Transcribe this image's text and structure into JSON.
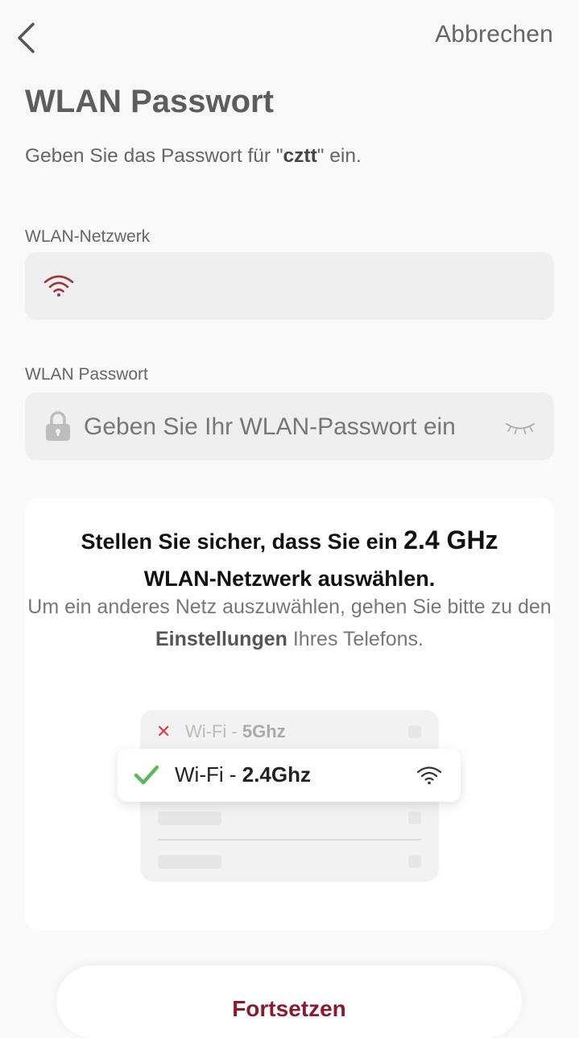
{
  "header": {
    "cancel_label": "Abbrechen"
  },
  "page": {
    "title": "WLAN Passwort",
    "subtitle_prefix": "Geben Sie das Passwort für \"",
    "network_name": "cztt",
    "subtitle_suffix": "\" ein."
  },
  "network_field": {
    "label": "WLAN-Netzwerk",
    "value": "",
    "icon": "wifi-icon"
  },
  "password_field": {
    "label": "WLAN Passwort",
    "placeholder": "Geben Sie Ihr WLAN-Passwort ein",
    "icon": "lock-icon",
    "toggle_icon": "eye-closed-icon"
  },
  "info_card": {
    "heading_part1": "Stellen Sie sicher, dass Sie ein",
    "heading_highlight": "2.4 GHz",
    "heading_part2": "WLAN-Netzwerk auswählen.",
    "text_part1": "Um ein anderes Netz auszuwählen, gehen Sie bitte zu den",
    "text_bold": "Einstellungen",
    "text_part2": "Ihres Telefons.",
    "illustration": {
      "wrong_prefix": "Wi-Fi - ",
      "wrong_band": "5Ghz",
      "right_prefix": "Wi-Fi - ",
      "right_band": "2.4Ghz"
    }
  },
  "bottom_button": {
    "label": "Fortsetzen"
  },
  "colors": {
    "accent": "#8b1a2e",
    "wifi_icon": "#a3343f",
    "check": "#5cb85c",
    "cross": "#e43d3d"
  }
}
